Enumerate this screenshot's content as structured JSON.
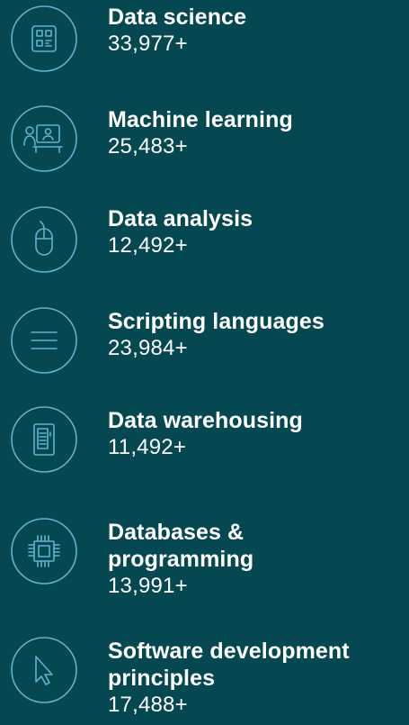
{
  "skills": [
    {
      "icon": "grid-icon",
      "title_lines": [
        "Data science"
      ],
      "count": "33,977+"
    },
    {
      "icon": "presenter-icon",
      "title_lines": [
        "Machine learning"
      ],
      "count": "25,483+"
    },
    {
      "icon": "mouse-icon",
      "title_lines": [
        "Data analysis"
      ],
      "count": "12,492+"
    },
    {
      "icon": "menu-icon",
      "title_lines": [
        "Scripting languages"
      ],
      "count": "23,984+"
    },
    {
      "icon": "server-icon",
      "title_lines": [
        "Data warehousing"
      ],
      "count": "11,492+"
    },
    {
      "icon": "chip-icon",
      "title_lines": [
        "Databases &",
        "programming"
      ],
      "count": "13,991+"
    },
    {
      "icon": "cursor-icon",
      "title_lines": [
        "Software development",
        "principles"
      ],
      "count": "17,488+"
    }
  ],
  "colors": {
    "background": "#064852",
    "icon_stroke": "#5fb3cf",
    "text": "#ffffff"
  }
}
